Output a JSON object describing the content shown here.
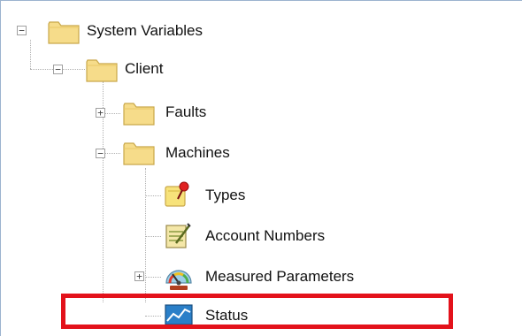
{
  "tree": {
    "system_variables": {
      "label": "System Variables",
      "expander": "−",
      "icon": "folder-icon"
    },
    "client": {
      "label": "Client",
      "expander": "−",
      "icon": "folder-icon"
    },
    "faults": {
      "label": "Faults",
      "expander": "+",
      "icon": "folder-icon"
    },
    "machines": {
      "label": "Machines",
      "expander": "−",
      "icon": "folder-icon"
    },
    "types": {
      "label": "Types",
      "icon": "types-icon"
    },
    "account_numbers": {
      "label": "Account Numbers",
      "icon": "notepad-icon"
    },
    "measured_parameters": {
      "label": "Measured Parameters",
      "expander": "+",
      "icon": "gauge-icon"
    },
    "status": {
      "label": "Status",
      "icon": "chart-icon"
    }
  },
  "colors": {
    "highlight_border": "#e3121b",
    "folder_fill": "#f6dc8a",
    "folder_edge": "#c9a84a"
  }
}
